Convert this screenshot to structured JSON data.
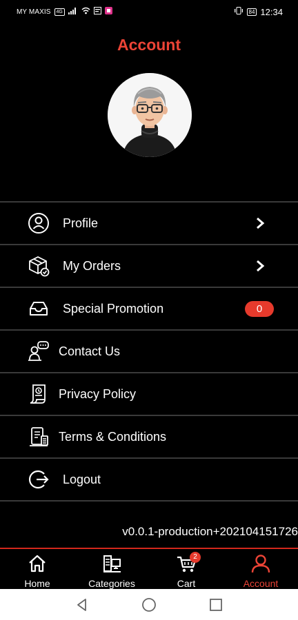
{
  "status_bar": {
    "carrier": "MY MAXIS",
    "network_chip": "4G",
    "battery": "84",
    "time": "12:34"
  },
  "page": {
    "title": "Account"
  },
  "menu": {
    "items": [
      {
        "label": "Profile",
        "icon": "user-circle-icon"
      },
      {
        "label": "My Orders",
        "icon": "package-check-icon"
      },
      {
        "label": "Special Promotion",
        "icon": "inbox-tray-icon",
        "badge": "0"
      },
      {
        "label": "Contact Us",
        "icon": "support-chat-icon"
      },
      {
        "label": "Privacy Policy",
        "icon": "document-icon"
      },
      {
        "label": "Terms & Conditions",
        "icon": "terms-document-icon"
      },
      {
        "label": "Logout",
        "icon": "logout-icon"
      }
    ]
  },
  "version": "v0.0.1-production+202104151726",
  "tab_bar": {
    "tabs": [
      {
        "label": "Home",
        "icon": "home-icon"
      },
      {
        "label": "Categories",
        "icon": "categories-icon"
      },
      {
        "label": "Cart",
        "icon": "cart-icon",
        "badge": "2"
      },
      {
        "label": "Account",
        "icon": "account-icon",
        "active": true
      }
    ]
  },
  "colors": {
    "accent": "#ec4436",
    "background": "#000000",
    "divider": "#3a3a3a"
  }
}
